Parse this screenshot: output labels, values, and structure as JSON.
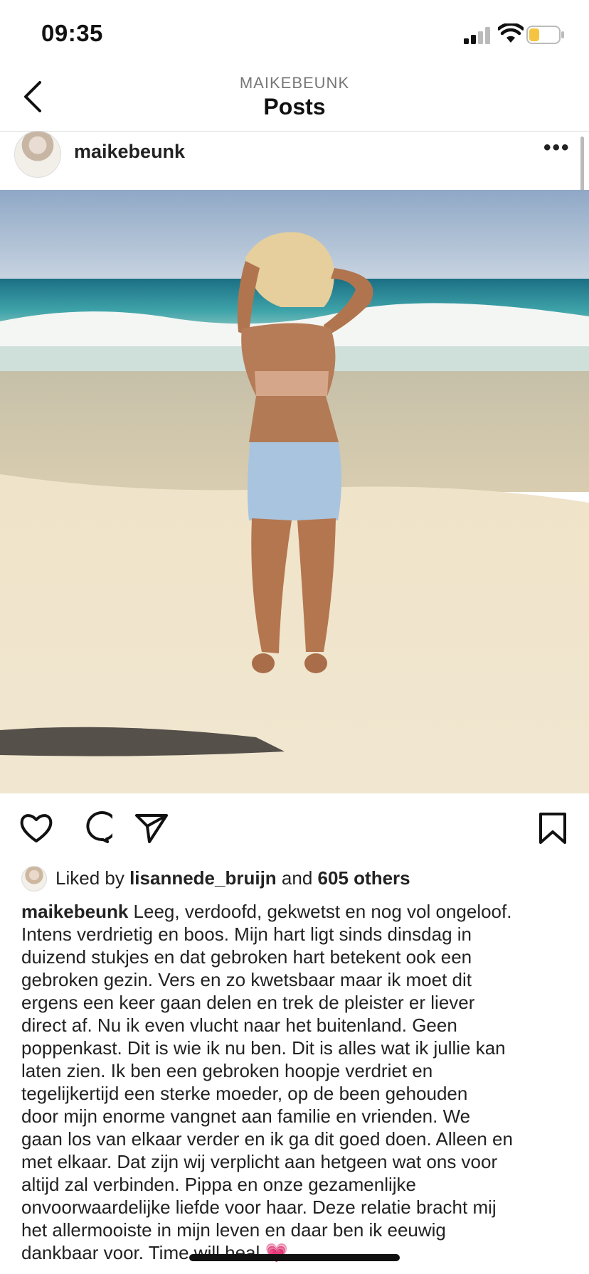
{
  "status_bar": {
    "time": "09:35"
  },
  "nav": {
    "subtitle": "MAIKEBEUNK",
    "title": "Posts"
  },
  "post": {
    "author": "maikebeunk",
    "likes": {
      "prefix": "Liked by",
      "user": "lisannede_bruijn",
      "middle": "and",
      "others": "605 others"
    },
    "caption_author": "maikebeunk",
    "caption_lines": [
      "Leeg, verdoofd, gekwetst en nog vol ongeloof.",
      "Intens verdrietig en boos. Mijn hart ligt sinds dinsdag in",
      "duizend stukjes en dat gebroken hart betekent ook een",
      "gebroken gezin. Vers en zo kwetsbaar maar ik moet dit",
      "ergens een keer gaan delen en trek de pleister er liever",
      "direct af. Nu ik even vlucht naar het buitenland. Geen",
      "poppenkast. Dit is wie ik nu ben. Dit is alles wat ik jullie kan",
      "laten zien. Ik ben een gebroken hoopje verdriet en",
      "tegelijkertijd een sterke moeder, op de been gehouden",
      "door mijn enorme vangnet aan familie en vrienden. We",
      "gaan los van elkaar verder en ik ga dit goed doen. Alleen en",
      "met elkaar. Dat zijn wij verplicht aan hetgeen wat ons voor",
      "altijd zal verbinden. Pippa en onze gezamenlijke",
      "onvoorwaardelijke liefde voor haar. Deze relatie bracht mij",
      "het allermooiste in mijn leven en daar ben ik eeuwig",
      "dankbaar voor. Time will heal 💗"
    ]
  },
  "icons": {
    "back": "chevron-left-icon",
    "more": "more-horizontal-icon",
    "like": "heart-icon",
    "comment": "comment-icon",
    "share": "send-icon",
    "save": "bookmark-icon"
  },
  "colors": {
    "battery_level": "#f5c542",
    "text": "#222222",
    "secondary": "#777777"
  }
}
